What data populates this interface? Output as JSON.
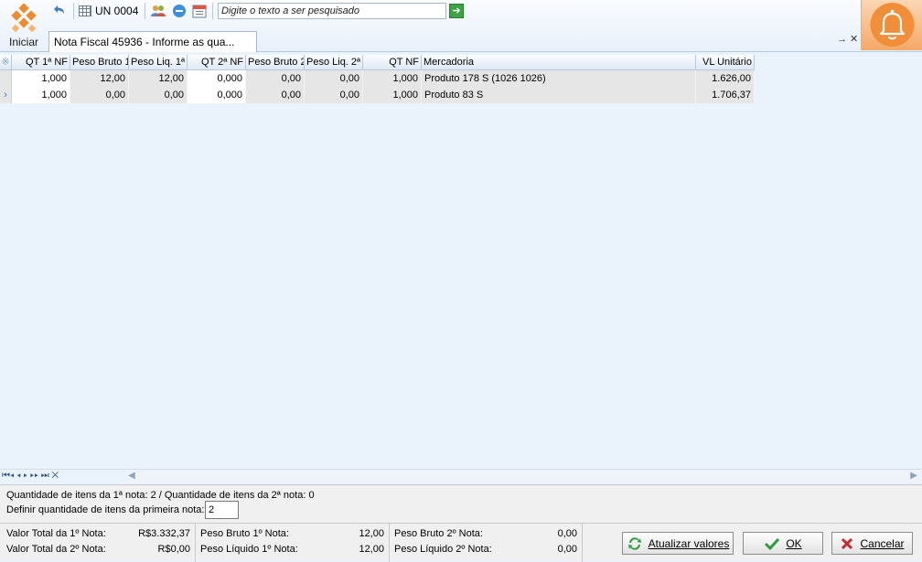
{
  "toolbar": {
    "start_label": "Iniciar",
    "un_label": "UN 0004",
    "search_placeholder": "Digite o texto a ser pesquisado"
  },
  "tab": {
    "title": "Nota Fiscal 45936 - Informe as qua...",
    "actions": "→ ✕"
  },
  "grid": {
    "columns": [
      "QT 1ª NF",
      "Peso Bruto 1",
      "Peso Liq. 1ª",
      "QT 2ª NF",
      "Peso Bruto 2",
      "Peso Liq. 2ª",
      "QT NF",
      "Mercadoria",
      "VL Unitário"
    ],
    "rows": [
      [
        "1,000",
        "12,00",
        "12,00",
        "0,000",
        "0,00",
        "0,00",
        "1,000",
        "Produto 178 S (1026 1026)",
        "1.626,00"
      ],
      [
        "1,000",
        "0,00",
        "0,00",
        "0,000",
        "0,00",
        "0,00",
        "1,000",
        "Produto 83 S",
        "1.706,37"
      ]
    ]
  },
  "info": {
    "line1": "Quantidade de itens da 1ª nota: 2 / Quantidade de itens da 2ª nota: 0",
    "line2_label": "Definir quantidade de itens da primeira nota:",
    "qty_value": "2"
  },
  "totals": {
    "valor_1_label": "Valor Total da 1º Nota:",
    "valor_1": "R$3.332,37",
    "valor_2_label": "Valor Total da 2º Nota:",
    "valor_2": "R$0,00",
    "peso_bruto_1_label": "Peso Bruto 1º Nota:",
    "peso_bruto_1": "12,00",
    "peso_liquido_1_label": "Peso Líquido 1º Nota:",
    "peso_liquido_1": "12,00",
    "peso_bruto_2_label": "Peso Bruto 2º Nota:",
    "peso_bruto_2": "0,00",
    "peso_liquido_2_label": "Peso Líquido 2º Nota:",
    "peso_liquido_2": "0,00"
  },
  "buttons": {
    "refresh": "Atualizar valores",
    "ok": "OK",
    "cancel": "Cancelar"
  },
  "colors": {
    "accent_orange": "#f6a866",
    "ok_green": "#2e9a3a",
    "cancel_red": "#c8282d"
  },
  "icons": [
    "app-logo-icon",
    "undo-icon",
    "grid-icon",
    "users-icon",
    "refresh-icon",
    "calendar-icon",
    "go-arrow-icon",
    "bell-icon",
    "pin-icon",
    "close-icon",
    "refresh-values-icon",
    "check-icon",
    "x-icon"
  ]
}
